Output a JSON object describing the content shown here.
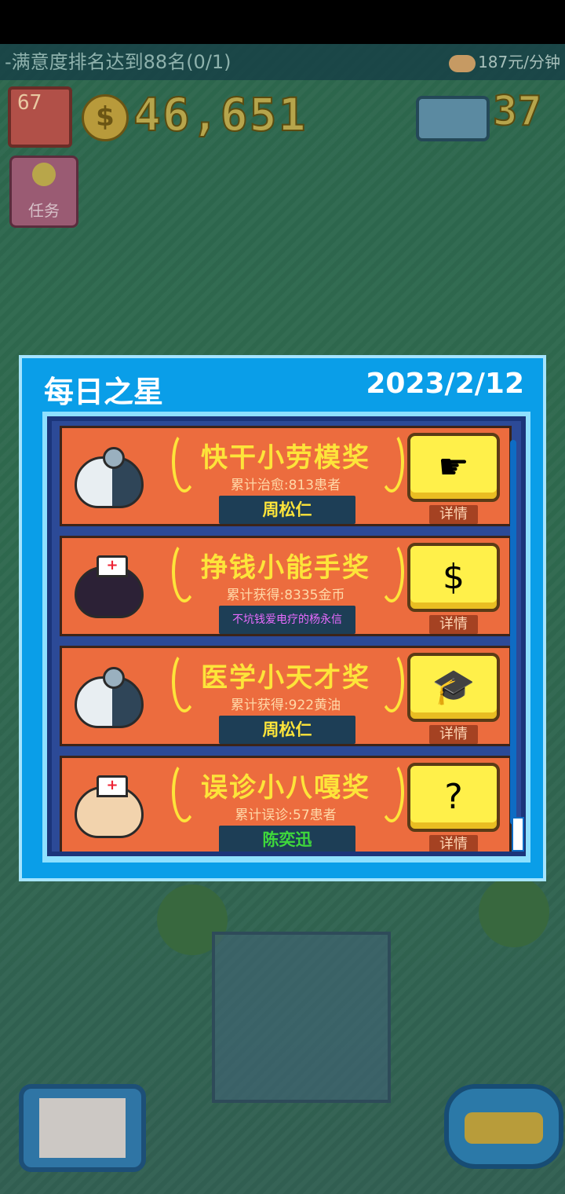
{
  "hud": {
    "quest_text": "-满意度排名达到88名(0/1)",
    "income_rate": "187元/分钟",
    "level": "67",
    "money": "46,651",
    "gems": "37",
    "task_label": "任务"
  },
  "modal": {
    "title": "每日之星",
    "date": "2023/2/12",
    "awards": [
      {
        "name": "快干小劳模奖",
        "stat": "累计治愈:813患者",
        "winner": "周松仁",
        "detail": "详情",
        "icon": "pointing-hand-icon",
        "avatar": "doctor-cat-avatar"
      },
      {
        "name": "挣钱小能手奖",
        "stat": "累计获得:8335金币",
        "winner": "不坑钱爱电疗的杨永信",
        "detail": "详情",
        "icon": "money-bag-icon",
        "avatar": "nurse-black-cat-avatar"
      },
      {
        "name": "医学小天才奖",
        "stat": "累计获得:922黄油",
        "winner": "周松仁",
        "detail": "详情",
        "icon": "graduate-cat-icon",
        "avatar": "doctor-cat-avatar"
      },
      {
        "name": "误诊小八嘎奖",
        "stat": "累计误诊:57患者",
        "winner": "陈奕迅",
        "detail": "详情",
        "icon": "confused-cat-icon",
        "avatar": "nurse-tan-cat-avatar"
      }
    ]
  },
  "colors": {
    "modal_blue": "#0a9ee8",
    "award_orange": "#ec6c3e",
    "award_gold": "#fde43a",
    "winner_purple": "#e96bff",
    "winner_green": "#3fd93b"
  }
}
